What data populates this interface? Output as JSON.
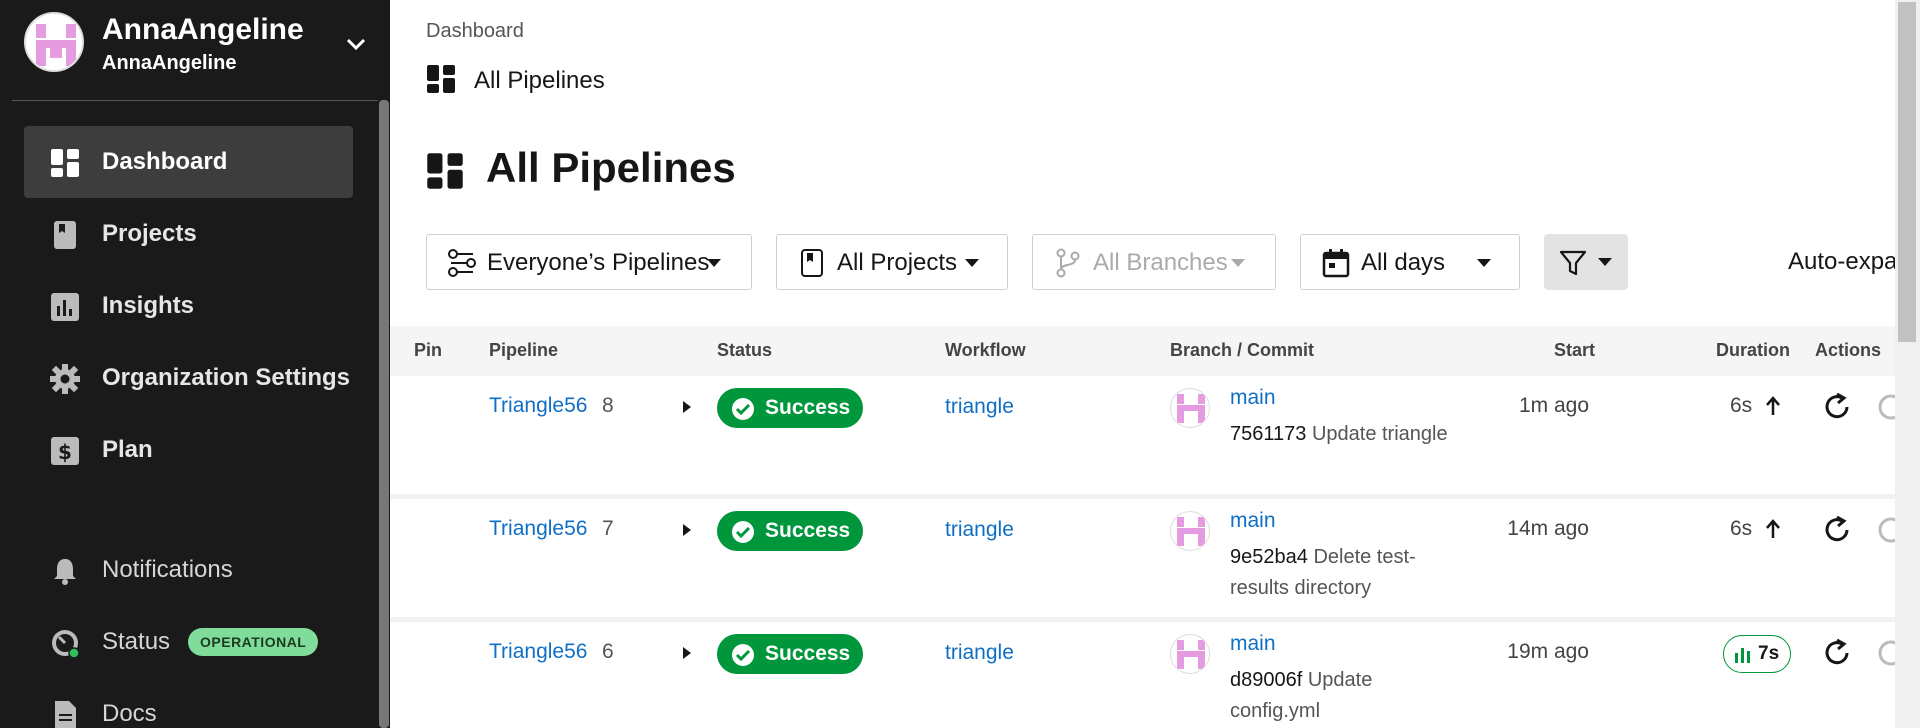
{
  "org": {
    "name": "AnnaAngeline",
    "subtitle": "AnnaAngeline"
  },
  "sidebar": {
    "items": [
      {
        "label": "Dashboard",
        "icon": "dashboard-icon",
        "active": true
      },
      {
        "label": "Projects",
        "icon": "projects-icon"
      },
      {
        "label": "Insights",
        "icon": "insights-icon"
      },
      {
        "label": "Organization Settings",
        "icon": "gear-icon"
      },
      {
        "label": "Plan",
        "icon": "dollar-icon"
      }
    ],
    "bottom_items": [
      {
        "label": "Notifications",
        "icon": "bell-icon"
      },
      {
        "label": "Status",
        "icon": "speedometer-icon",
        "badge": "OPERATIONAL"
      },
      {
        "label": "Docs",
        "icon": "document-icon"
      }
    ]
  },
  "breadcrumb": {
    "parent": "Dashboard",
    "current": "All Pipelines"
  },
  "page": {
    "title": "All Pipelines"
  },
  "filters": {
    "pipelines": "Everyone’s Pipelines",
    "projects": "All Projects",
    "branches": "All Branches",
    "days": "All days",
    "auto_expand": "Auto-expa"
  },
  "table": {
    "headers": [
      "Pin",
      "Pipeline",
      "Status",
      "Workflow",
      "Branch / Commit",
      "Start",
      "Duration",
      "Actions"
    ],
    "rows": [
      {
        "project": "Triangle56",
        "number": "8",
        "status": "Success",
        "workflow": "triangle",
        "branch": "main",
        "hash": "7561173",
        "message": "Update triangle",
        "start": "1m ago",
        "duration": "6s"
      },
      {
        "project": "Triangle56",
        "number": "7",
        "status": "Success",
        "workflow": "triangle",
        "branch": "main",
        "hash": "9e52ba4",
        "message": "Delete test-results directory",
        "start": "14m ago",
        "duration": "6s"
      },
      {
        "project": "Triangle56",
        "number": "6",
        "status": "Success",
        "workflow": "triangle",
        "branch": "main",
        "hash": "d89006f",
        "message": "Update config.yml",
        "start": "19m ago",
        "duration": "7s"
      }
    ]
  },
  "colors": {
    "sidebar_bg": "#1a1a1a",
    "link": "#0f6fc6",
    "success": "#00963b",
    "badge_operational": "#7fdc9a"
  }
}
